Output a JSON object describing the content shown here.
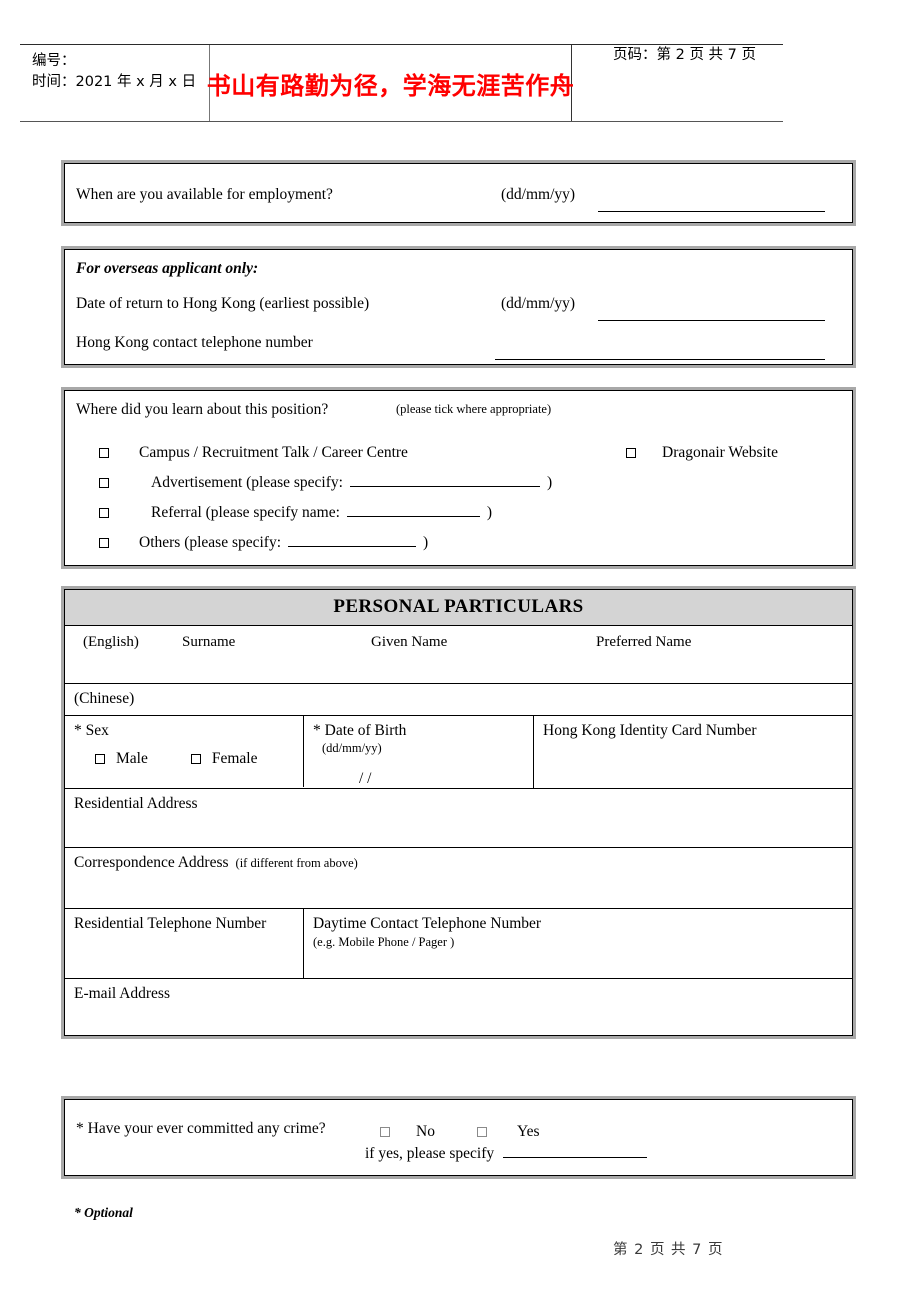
{
  "header": {
    "label_number": "编号：",
    "label_time": "时间：2021 年 x 月 x 日",
    "motto": "书山有路勤为径，学海无涯苦作舟",
    "page_label": "页码：第 2 页  共 7 页",
    "motto_color": "#ff0000"
  },
  "availability": {
    "question": "When are you available for employment?",
    "format_hint": "(dd/mm/yy)"
  },
  "overseas": {
    "heading": "For overseas applicant only:",
    "return_date_label": "Date of return to Hong Kong (earliest possible)",
    "return_date_hint": "(dd/mm/yy)",
    "phone_label": "Hong Kong contact telephone number"
  },
  "source": {
    "question": "Where did you learn about this position?",
    "instruction": "(please tick where appropriate)",
    "options": [
      {
        "label": "Campus / Recruitment Talk / Career Centre"
      },
      {
        "label": "Advertisement (please specify:",
        "suffix": ")"
      },
      {
        "label": "Referral (please specify name:",
        "suffix": ")"
      },
      {
        "label": "Others (please specify:",
        "suffix": ")"
      }
    ],
    "right_option": {
      "label": "Dragonair Website"
    }
  },
  "personal": {
    "title": "PERSONAL PARTICULARS",
    "name_columns": [
      "Surname",
      "Given Name",
      "Preferred Name"
    ],
    "english_label": "(English)",
    "chinese_label": "(Chinese)",
    "sex_label": "* Sex",
    "sex_options": [
      "Male",
      "Female"
    ],
    "dob_label": "* Date of Birth",
    "dob_hint": "(dd/mm/yy)",
    "dob_slashes": "/         /",
    "hkid_label": "Hong Kong Identity Card Number",
    "residential_address_label": "Residential Address",
    "correspondence_address_label": "Correspondence Address",
    "correspondence_address_note": "(if different from above)",
    "residential_phone_label": "Residential Telephone Number",
    "daytime_phone_label": "Daytime Contact Telephone Number",
    "daytime_phone_note": "(e.g. Mobile Phone / Pager )",
    "email_label": "E-mail Address"
  },
  "crime": {
    "question": "* Have your ever committed any crime?",
    "option_no": "No",
    "option_yes": "Yes",
    "specify_label": "if yes, please specify"
  },
  "footer": {
    "optional_note": "* Optional",
    "page_label": "第 2 页 共 7 页"
  }
}
